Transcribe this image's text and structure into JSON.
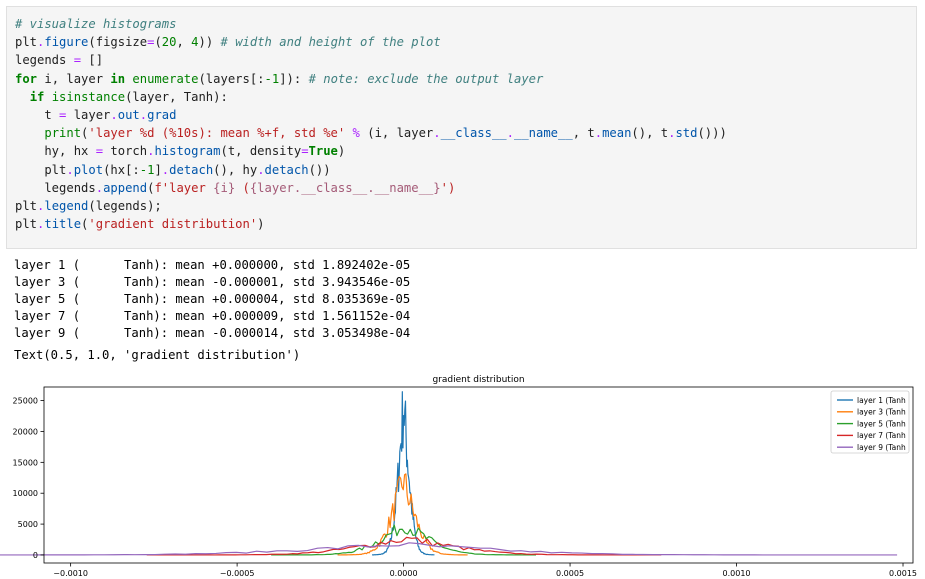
{
  "code_lines": [
    [
      {
        "t": "# visualize histograms",
        "c": "comment"
      }
    ],
    [
      {
        "t": "plt",
        "c": "name"
      },
      {
        "t": ".",
        "c": "op"
      },
      {
        "t": "figure",
        "c": "attr"
      },
      {
        "t": "(",
        "c": "name"
      },
      {
        "t": "figsize",
        "c": "name"
      },
      {
        "t": "=",
        "c": "op"
      },
      {
        "t": "(",
        "c": "name"
      },
      {
        "t": "20",
        "c": "num"
      },
      {
        "t": ", ",
        "c": "name"
      },
      {
        "t": "4",
        "c": "num"
      },
      {
        "t": ")) ",
        "c": "name"
      },
      {
        "t": "# width and height of the plot",
        "c": "comment"
      }
    ],
    [
      {
        "t": "legends ",
        "c": "name"
      },
      {
        "t": "=",
        "c": "op"
      },
      {
        "t": " []",
        "c": "name"
      }
    ],
    [
      {
        "t": "for",
        "c": "kw"
      },
      {
        "t": " i, layer ",
        "c": "name"
      },
      {
        "t": "in",
        "c": "kw"
      },
      {
        "t": " ",
        "c": "name"
      },
      {
        "t": "enumerate",
        "c": "builtin"
      },
      {
        "t": "(layers[:",
        "c": "name"
      },
      {
        "t": "-1",
        "c": "num"
      },
      {
        "t": "]): ",
        "c": "name"
      },
      {
        "t": "# note: exclude the output layer",
        "c": "comment"
      }
    ],
    [
      {
        "t": "  ",
        "c": "name"
      },
      {
        "t": "if",
        "c": "kw"
      },
      {
        "t": " ",
        "c": "name"
      },
      {
        "t": "isinstance",
        "c": "builtin"
      },
      {
        "t": "(layer, Tanh):",
        "c": "name"
      }
    ],
    [
      {
        "t": "    t ",
        "c": "name"
      },
      {
        "t": "=",
        "c": "op"
      },
      {
        "t": " layer",
        "c": "name"
      },
      {
        "t": ".",
        "c": "op"
      },
      {
        "t": "out",
        "c": "attr"
      },
      {
        "t": ".",
        "c": "op"
      },
      {
        "t": "grad",
        "c": "attr"
      }
    ],
    [
      {
        "t": "    ",
        "c": "name"
      },
      {
        "t": "print",
        "c": "builtin"
      },
      {
        "t": "(",
        "c": "name"
      },
      {
        "t": "'layer %d (%10s): mean %+f, std %e'",
        "c": "str"
      },
      {
        "t": " ",
        "c": "name"
      },
      {
        "t": "%",
        "c": "op"
      },
      {
        "t": " (i, layer",
        "c": "name"
      },
      {
        "t": ".",
        "c": "op"
      },
      {
        "t": "__class__",
        "c": "attr"
      },
      {
        "t": ".",
        "c": "op"
      },
      {
        "t": "__name__",
        "c": "attr"
      },
      {
        "t": ", t",
        "c": "name"
      },
      {
        "t": ".",
        "c": "op"
      },
      {
        "t": "mean",
        "c": "attr"
      },
      {
        "t": "(), t",
        "c": "name"
      },
      {
        "t": ".",
        "c": "op"
      },
      {
        "t": "std",
        "c": "attr"
      },
      {
        "t": "()))",
        "c": "name"
      }
    ],
    [
      {
        "t": "    hy, hx ",
        "c": "name"
      },
      {
        "t": "=",
        "c": "op"
      },
      {
        "t": " torch",
        "c": "name"
      },
      {
        "t": ".",
        "c": "op"
      },
      {
        "t": "histogram",
        "c": "attr"
      },
      {
        "t": "(t, density",
        "c": "name"
      },
      {
        "t": "=",
        "c": "op"
      },
      {
        "t": "True",
        "c": "kw"
      },
      {
        "t": ")",
        "c": "name"
      }
    ],
    [
      {
        "t": "    plt",
        "c": "name"
      },
      {
        "t": ".",
        "c": "op"
      },
      {
        "t": "plot",
        "c": "attr"
      },
      {
        "t": "(hx[:",
        "c": "name"
      },
      {
        "t": "-1",
        "c": "num"
      },
      {
        "t": "]",
        "c": "name"
      },
      {
        "t": ".",
        "c": "op"
      },
      {
        "t": "detach",
        "c": "attr"
      },
      {
        "t": "(), hy",
        "c": "name"
      },
      {
        "t": ".",
        "c": "op"
      },
      {
        "t": "detach",
        "c": "attr"
      },
      {
        "t": "())",
        "c": "name"
      }
    ],
    [
      {
        "t": "    legends",
        "c": "name"
      },
      {
        "t": ".",
        "c": "op"
      },
      {
        "t": "append",
        "c": "attr"
      },
      {
        "t": "(",
        "c": "name"
      },
      {
        "t": "f'layer ",
        "c": "str"
      },
      {
        "t": "{i}",
        "c": "interp"
      },
      {
        "t": " (",
        "c": "str"
      },
      {
        "t": "{layer.__class__.__name__}",
        "c": "interp"
      },
      {
        "t": "')",
        "c": "str"
      }
    ],
    [
      {
        "t": "plt",
        "c": "name"
      },
      {
        "t": ".",
        "c": "op"
      },
      {
        "t": "legend",
        "c": "attr"
      },
      {
        "t": "(legends);",
        "c": "name"
      }
    ],
    [
      {
        "t": "plt",
        "c": "name"
      },
      {
        "t": ".",
        "c": "op"
      },
      {
        "t": "title",
        "c": "attr"
      },
      {
        "t": "(",
        "c": "name"
      },
      {
        "t": "'gradient distribution'",
        "c": "str"
      },
      {
        "t": ")",
        "c": "name"
      }
    ]
  ],
  "stdout": [
    "layer 1 (      Tanh): mean +0.000000, std 1.892402e-05",
    "layer 3 (      Tanh): mean -0.000001, std 3.943546e-05",
    "layer 5 (      Tanh): mean +0.000004, std 8.035369e-05",
    "layer 7 (      Tanh): mean +0.000009, std 1.561152e-04",
    "layer 9 (      Tanh): mean -0.000014, std 3.053498e-04"
  ],
  "result_text": "Text(0.5, 1.0, 'gradient distribution')",
  "chart_data": {
    "type": "line",
    "title": "gradient distribution",
    "xlabel": "",
    "ylabel": "",
    "xlim": [
      -0.00108,
      0.00153
    ],
    "ylim": [
      -1300,
      27200
    ],
    "xticks": [
      -0.001,
      -0.0005,
      0.0,
      0.0005,
      0.001,
      0.0015
    ],
    "xtick_labels": [
      "−0.0010",
      "−0.0005",
      "0.0000",
      "0.0005",
      "0.0010",
      "0.0015"
    ],
    "yticks": [
      0,
      5000,
      10000,
      15000,
      20000,
      25000
    ],
    "ytick_labels": [
      "0",
      "5000",
      "10000",
      "15000",
      "20000",
      "25000"
    ],
    "legend_position": "upper right",
    "series": [
      {
        "name": "layer 1 (Tanh",
        "color": "#1f77b4",
        "mean": 0.0,
        "std": 1.892402e-05
      },
      {
        "name": "layer 3 (Tanh",
        "color": "#ff7f0e",
        "mean": -1e-06,
        "std": 3.943546e-05
      },
      {
        "name": "layer 5 (Tanh",
        "color": "#2ca02c",
        "mean": 4e-06,
        "std": 8.035369e-05
      },
      {
        "name": "layer 7 (Tanh",
        "color": "#d62728",
        "mean": 9e-06,
        "std": 0.0001561152
      },
      {
        "name": "layer 9 (Tanh",
        "color": "#9467bd",
        "mean": -1.4e-05,
        "std": 0.0003053498
      }
    ]
  }
}
